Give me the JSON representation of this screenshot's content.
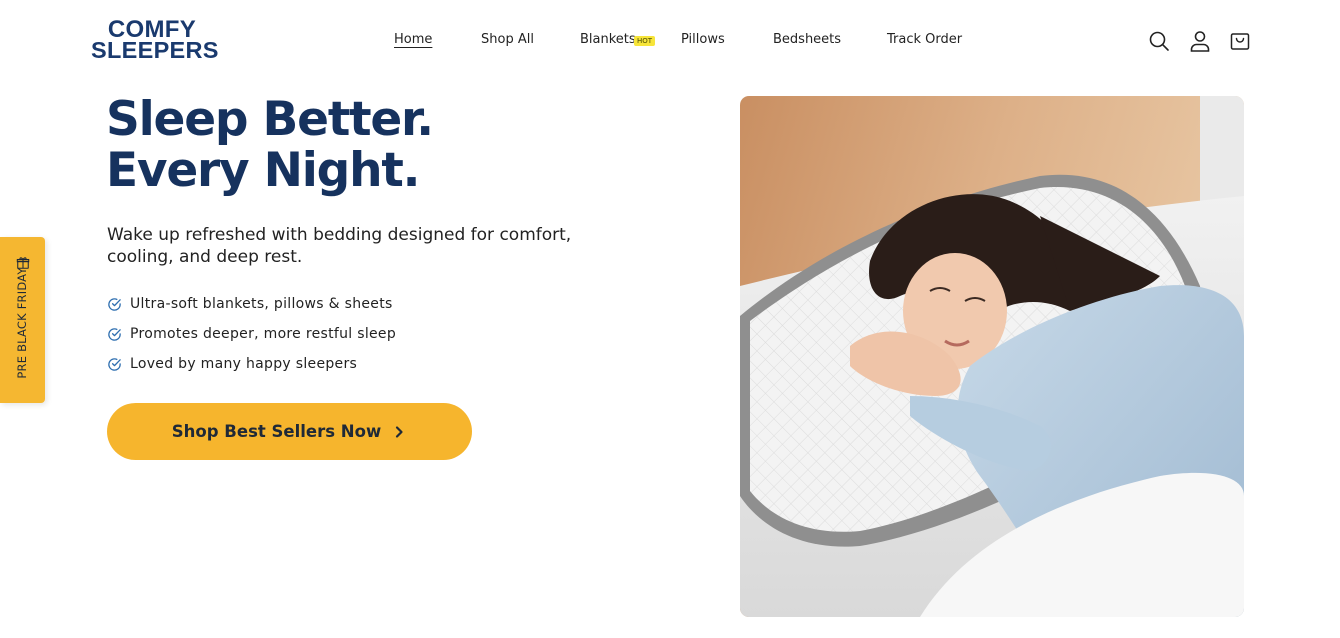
{
  "brand": {
    "line1": "COMFY",
    "line2": "SLEEPERS"
  },
  "nav": {
    "items": [
      {
        "label": "Home"
      },
      {
        "label": "Shop All"
      },
      {
        "label": "Blankets"
      },
      {
        "label": "Pillows"
      },
      {
        "label": "Bedsheets"
      },
      {
        "label": "Track Order"
      }
    ],
    "hot_badge": "HOT"
  },
  "header_icons": [
    "search-icon",
    "account-icon",
    "cart-icon"
  ],
  "side_tab": {
    "label": "PRE BLACK FRIDAY",
    "icon": "gift-icon"
  },
  "hero": {
    "title_line1": "Sleep Better.",
    "title_line2": "Every Night.",
    "subtitle": "Wake up refreshed with bedding designed for comfort, cooling, and deep rest.",
    "features": [
      "Ultra-soft blankets, pillows & sheets",
      "Promotes deeper, more restful sleep",
      "Loved by many happy sleepers"
    ],
    "cta_label": "Shop Best Sellers Now",
    "image": "woman sleeping on white pillow"
  },
  "colors": {
    "brand_navy": "#16325e",
    "accent_yellow": "#f6b52d",
    "hot_badge": "#f7e53a",
    "check_blue": "#2f6fb0"
  }
}
